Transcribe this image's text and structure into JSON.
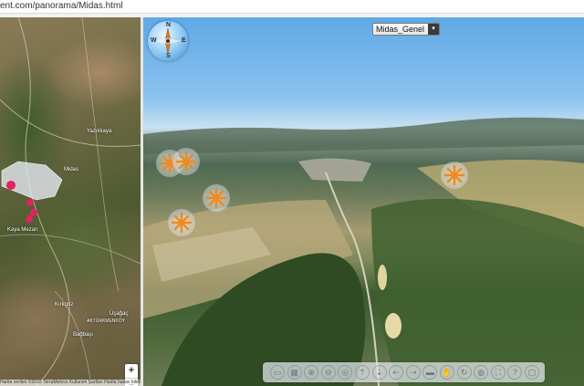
{
  "browser": {
    "url": "ent.com/panorama/Midas.html"
  },
  "map": {
    "labels": [
      "Midas",
      "Yazılıkaya",
      "Kaya Mezarı",
      "Kırkgöz",
      "AKTÜRKMENKÖY",
      "Bağbaşı",
      "Üçağaç"
    ],
    "zoom_in": "+",
    "zoom_out": "−",
    "attribution": "Harita verileri ©2018 TerraMetrics   Kullanım Şartları   Harita hatası bildirin"
  },
  "panorama": {
    "scene_select": "Midas_Genel",
    "select_arrow": "▾",
    "compass": {
      "n": "N",
      "s": "S",
      "w": "W",
      "e": "E"
    },
    "hotspot_count": 5,
    "toolbar_icons": [
      "hide-toolbar-icon",
      "map-toggle-icon",
      "zoom-in-icon",
      "zoom-out-icon",
      "rotate-left-icon",
      "move-up-icon",
      "move-down-icon",
      "move-left-icon",
      "move-right-icon",
      "sound-icon",
      "hand-drag-icon",
      "autorotate-icon",
      "globe-icon",
      "fullscreen-icon",
      "help-icon",
      "close-icon"
    ],
    "toolbar_glyphs": [
      "▭",
      "▦",
      "⊕",
      "⊖",
      "◎",
      "⇡",
      "⇣",
      "⇠",
      "⇢",
      "▬",
      "✋",
      "↻",
      "◍",
      "⛶",
      "?",
      "▢"
    ]
  },
  "colors": {
    "sky": "#5fa9e6",
    "hotspot": "#f08a1e",
    "map_marker": "#e0245e",
    "map_area": "#dfe6ef"
  }
}
